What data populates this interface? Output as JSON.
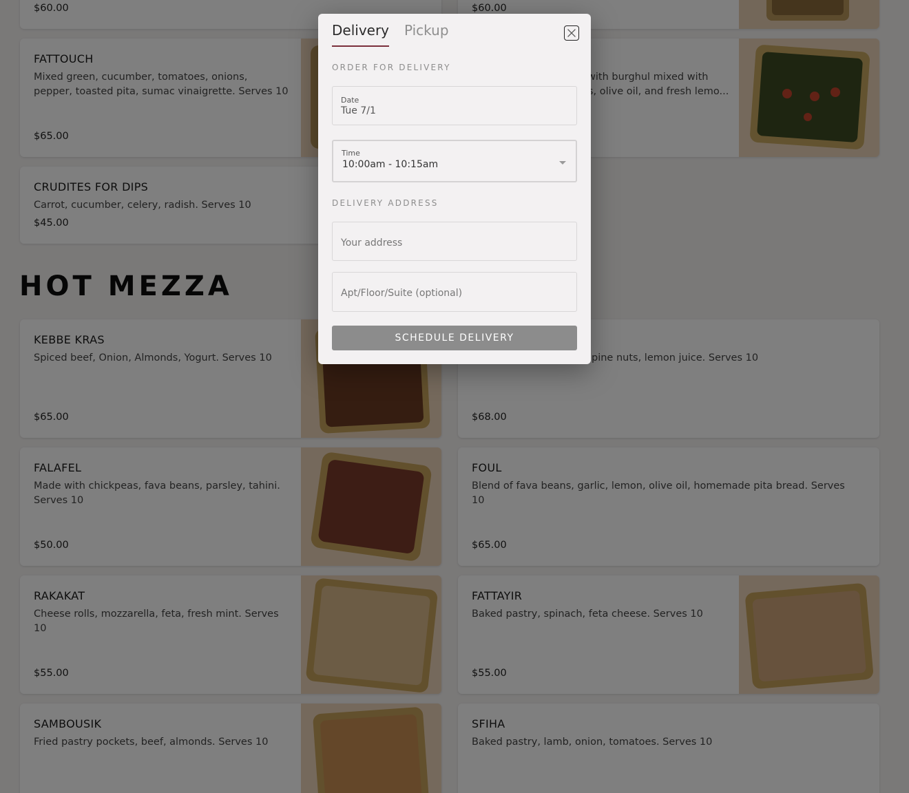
{
  "colors": {
    "accent": "#7a2f3b",
    "overlay": "rgba(0,0,0,0.5)",
    "button_disabled": "#8c8c8c"
  },
  "top_row": [
    {
      "price": "$60.00"
    },
    {
      "price": "$60.00"
    }
  ],
  "cold_items": [
    {
      "name": "FATTOUCH",
      "description": "Mixed green, cucumber, tomatoes, onions, pepper, toasted pita, sumac vinaigrette. Serves 10",
      "price": "$65.00"
    },
    {
      "name": "",
      "description": "with burghul mixed with",
      "description2": "es, olive oil, and fresh lemo...",
      "price": ""
    },
    {
      "name": "CRUDITES FOR DIPS",
      "description": "Carrot, cucumber, celery, radish. Serves 10",
      "price": "$45.00"
    }
  ],
  "section_title": "HOT MEZZA",
  "hot_items": [
    {
      "name": "KEBBE KRAS",
      "description": "Spiced beef, Onion, Almonds, Yogurt. Serves 10",
      "price": "$65.00"
    },
    {
      "name": "",
      "description": "pine nuts, lemon juice. Serves 10",
      "price": "$68.00"
    },
    {
      "name": "FALAFEL",
      "description": "Made with chickpeas, fava beans, parsley, tahini. Serves 10",
      "price": "$50.00"
    },
    {
      "name": "FOUL",
      "description": "Blend of fava beans, garlic, lemon, olive oil, homemade pita bread. Serves 10",
      "price": "$65.00"
    },
    {
      "name": "RAKAKAT",
      "description": "Cheese rolls, mozzarella, feta, fresh mint. Serves 10",
      "price": "$55.00"
    },
    {
      "name": "FATTAYIR",
      "description": "Baked pastry, spinach, feta cheese. Serves 10",
      "price": "$55.00"
    },
    {
      "name": "SAMBOUSIK",
      "description": "Fried pastry pockets, beef, almonds. Serves 10",
      "price": ""
    },
    {
      "name": "SFIHA",
      "description": "Baked pastry, lamb, onion, tomatoes. Serves 10",
      "price": ""
    }
  ],
  "modal": {
    "tabs": [
      "Delivery",
      "Pickup"
    ],
    "active_tab": "Delivery",
    "order_label": "ORDER FOR DELIVERY",
    "date_label": "Date",
    "date_value": "Tue 7/1",
    "time_label": "Time",
    "time_value": "10:00am - 10:15am",
    "address_label": "DELIVERY ADDRESS",
    "address_placeholder": "Your address",
    "apt_placeholder": "Apt/Floor/Suite (optional)",
    "submit_label": "SCHEDULE DELIVERY",
    "close_icon": "close-icon"
  }
}
